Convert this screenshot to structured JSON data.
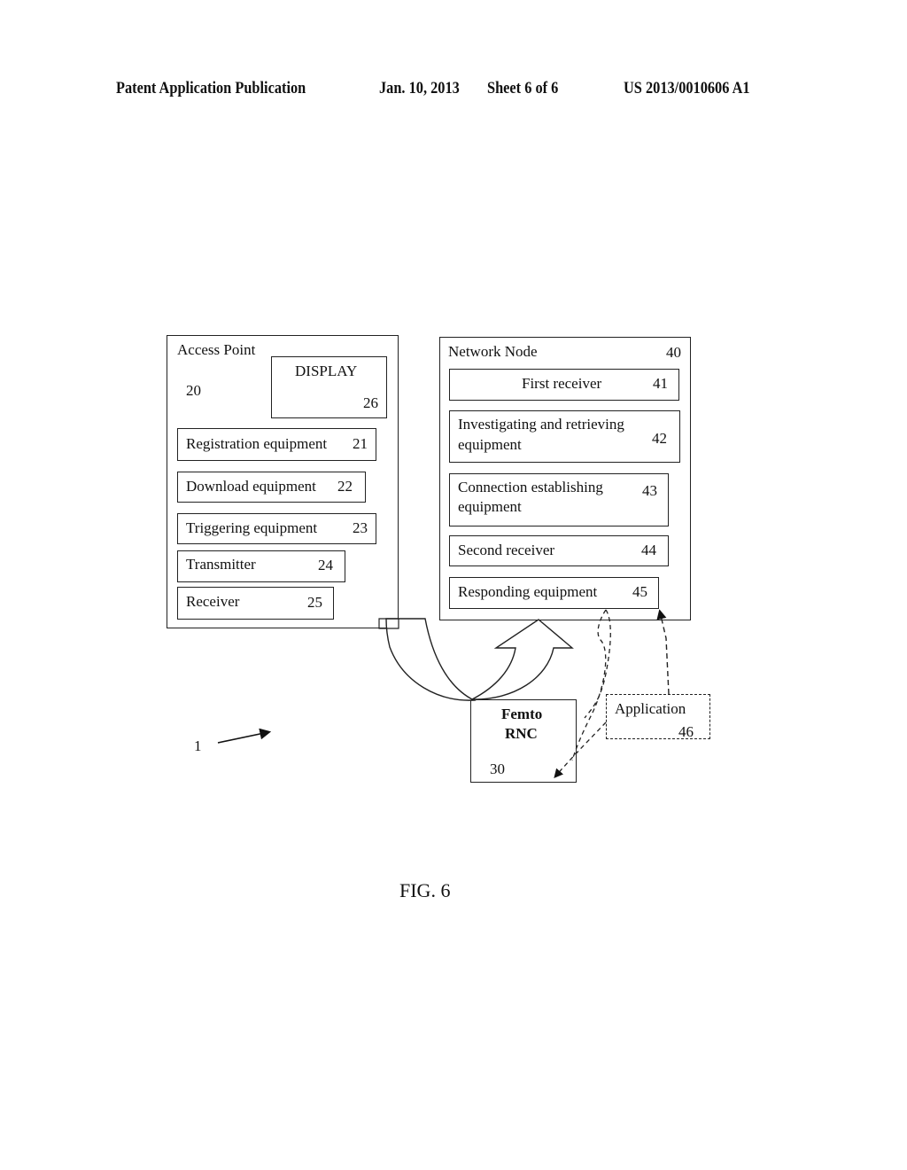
{
  "header": {
    "publication": "Patent Application Publication",
    "date": "Jan. 10, 2013",
    "sheet": "Sheet 6 of 6",
    "number": "US 2013/0010606 A1"
  },
  "system_ref": "1",
  "access_point": {
    "title": "Access Point",
    "ref": "20",
    "display": {
      "label": "DISPLAY",
      "ref": "26"
    },
    "items": [
      {
        "label": "Registration equipment",
        "ref": "21"
      },
      {
        "label": "Download equipment",
        "ref": "22"
      },
      {
        "label": "Triggering equipment",
        "ref": "23"
      },
      {
        "label": "Transmitter",
        "ref": "24"
      },
      {
        "label": "Receiver",
        "ref": "25"
      }
    ]
  },
  "network_node": {
    "title": "Network Node",
    "ref": "40",
    "items": [
      {
        "label": "First receiver",
        "ref": "41"
      },
      {
        "label": "Investigating and retrieving",
        "label2": "equipment",
        "ref": "42"
      },
      {
        "label": "Connection establishing",
        "label2": "equipment",
        "ref": "43"
      },
      {
        "label": "Second receiver",
        "ref": "44"
      },
      {
        "label": "Responding equipment",
        "ref": "45"
      }
    ]
  },
  "femto_rnc": {
    "line1": "Femto",
    "line2": "RNC",
    "ref": "30"
  },
  "application": {
    "label": "Application",
    "ref": "46"
  },
  "figure_label": "FIG. 6"
}
